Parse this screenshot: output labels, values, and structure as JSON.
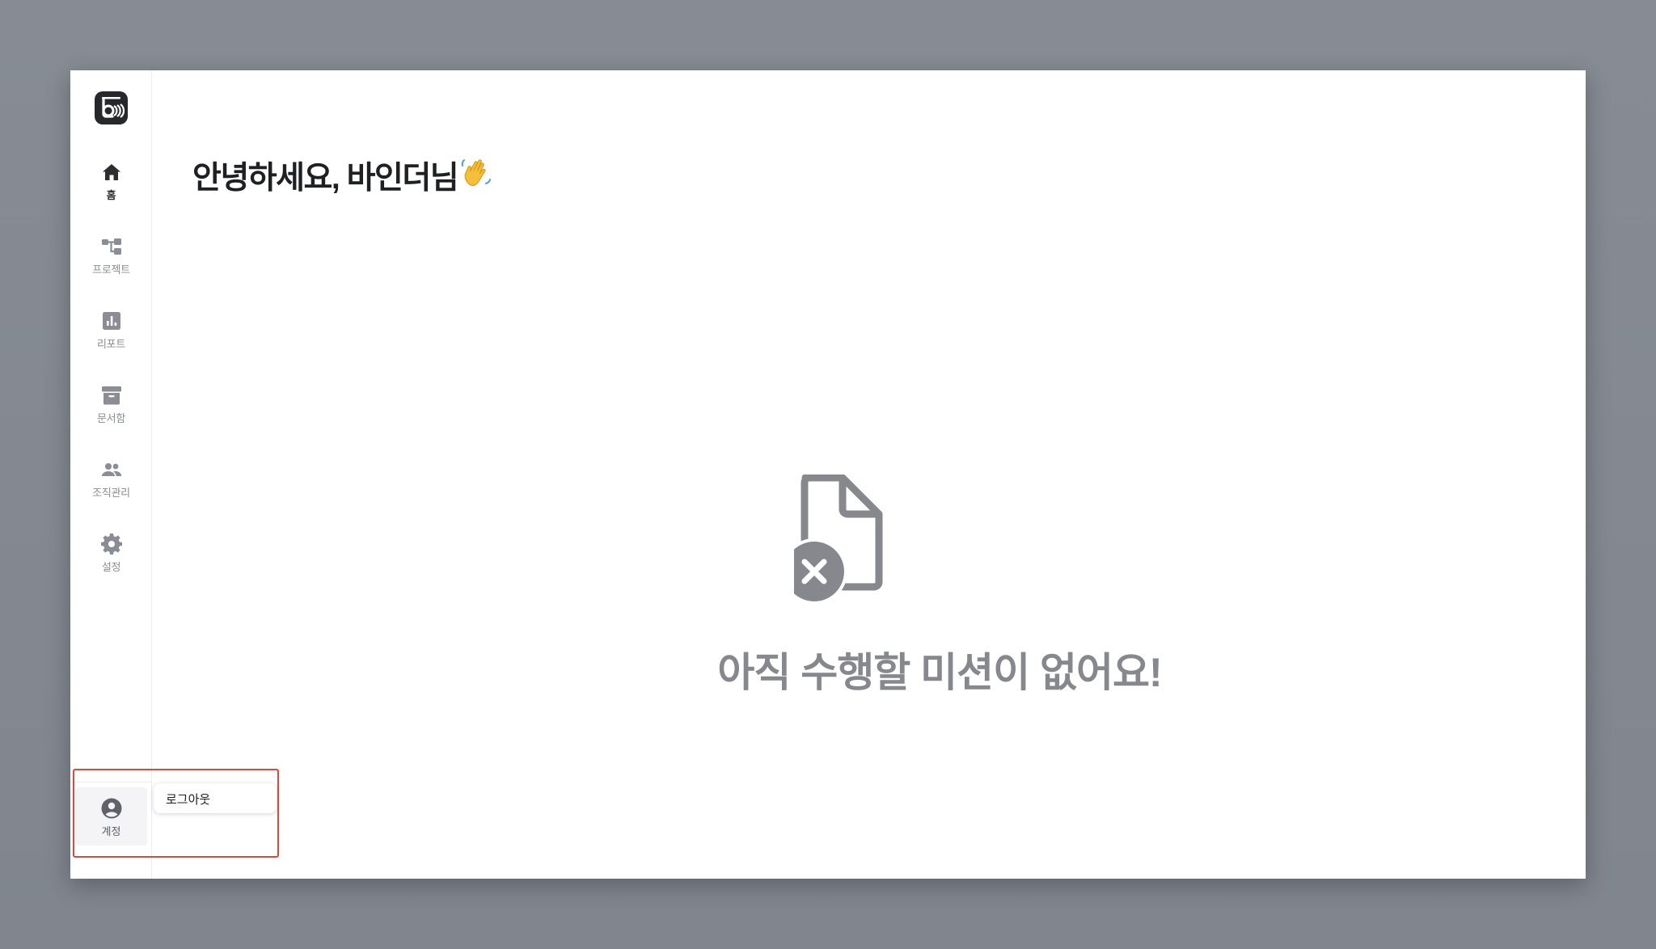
{
  "sidebar": {
    "logo_icon": "binder-logo-icon",
    "items": [
      {
        "label": "홈",
        "icon": "home-icon",
        "active": true
      },
      {
        "label": "프로젝트",
        "icon": "project-tree-icon",
        "active": false
      },
      {
        "label": "리포트",
        "icon": "report-chart-icon",
        "active": false
      },
      {
        "label": "문서함",
        "icon": "archive-box-icon",
        "active": false
      },
      {
        "label": "조직관리",
        "icon": "people-group-icon",
        "active": false
      },
      {
        "label": "설정",
        "icon": "gear-icon",
        "active": false
      }
    ],
    "account": {
      "label": "계정",
      "icon": "user-circle-icon"
    }
  },
  "account_menu": {
    "logout_label": "로그아웃"
  },
  "main": {
    "greeting": "안녕하세요, 바인더님",
    "greeting_emoji": "waving-hand-icon",
    "empty_state": {
      "icon": "document-error-icon",
      "message": "아직 수행할 미션이 없어요!"
    }
  },
  "colors": {
    "backdrop": "#878c94",
    "highlight": "#e0463a",
    "icon_inactive": "#8a8d93",
    "icon_active": "#2b2d31",
    "empty_text": "#86888e"
  }
}
